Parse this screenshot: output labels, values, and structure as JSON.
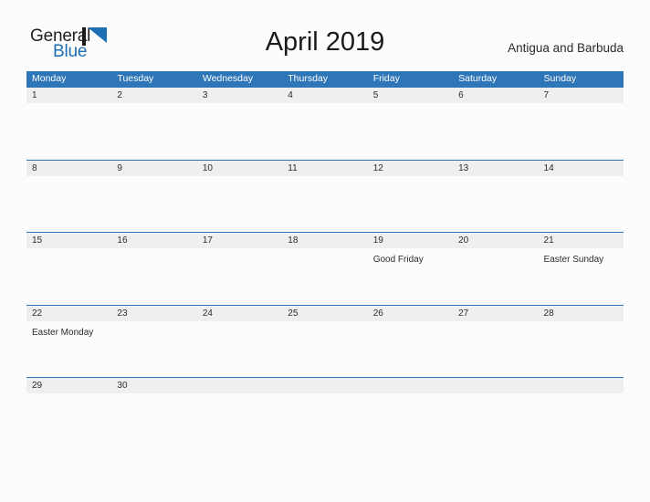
{
  "brand": {
    "name_dark": "General",
    "name_blue": "Blue",
    "mark": "triangle-icon",
    "dark_color": "#231f20",
    "blue_color": "#1f6fb5"
  },
  "header": {
    "title": "April 2019",
    "country": "Antigua and Barbuda"
  },
  "theme": {
    "accent": "#2e76b8",
    "date_band": "#efefef",
    "page_background": "#fcfcfc",
    "text": "#2b2b2b"
  },
  "calendar": {
    "weekdays": [
      "Monday",
      "Tuesday",
      "Wednesday",
      "Thursday",
      "Friday",
      "Saturday",
      "Sunday"
    ],
    "weeks": [
      {
        "days": [
          {
            "date": "1",
            "event": ""
          },
          {
            "date": "2",
            "event": ""
          },
          {
            "date": "3",
            "event": ""
          },
          {
            "date": "4",
            "event": ""
          },
          {
            "date": "5",
            "event": ""
          },
          {
            "date": "6",
            "event": ""
          },
          {
            "date": "7",
            "event": ""
          }
        ]
      },
      {
        "days": [
          {
            "date": "8",
            "event": ""
          },
          {
            "date": "9",
            "event": ""
          },
          {
            "date": "10",
            "event": ""
          },
          {
            "date": "11",
            "event": ""
          },
          {
            "date": "12",
            "event": ""
          },
          {
            "date": "13",
            "event": ""
          },
          {
            "date": "14",
            "event": ""
          }
        ]
      },
      {
        "days": [
          {
            "date": "15",
            "event": ""
          },
          {
            "date": "16",
            "event": ""
          },
          {
            "date": "17",
            "event": ""
          },
          {
            "date": "18",
            "event": ""
          },
          {
            "date": "19",
            "event": "Good Friday"
          },
          {
            "date": "20",
            "event": ""
          },
          {
            "date": "21",
            "event": "Easter Sunday"
          }
        ]
      },
      {
        "days": [
          {
            "date": "22",
            "event": "Easter Monday"
          },
          {
            "date": "23",
            "event": ""
          },
          {
            "date": "24",
            "event": ""
          },
          {
            "date": "25",
            "event": ""
          },
          {
            "date": "26",
            "event": ""
          },
          {
            "date": "27",
            "event": ""
          },
          {
            "date": "28",
            "event": ""
          }
        ]
      },
      {
        "days": [
          {
            "date": "29",
            "event": ""
          },
          {
            "date": "30",
            "event": ""
          },
          {
            "date": "",
            "event": ""
          },
          {
            "date": "",
            "event": ""
          },
          {
            "date": "",
            "event": ""
          },
          {
            "date": "",
            "event": ""
          },
          {
            "date": "",
            "event": ""
          }
        ]
      }
    ]
  }
}
